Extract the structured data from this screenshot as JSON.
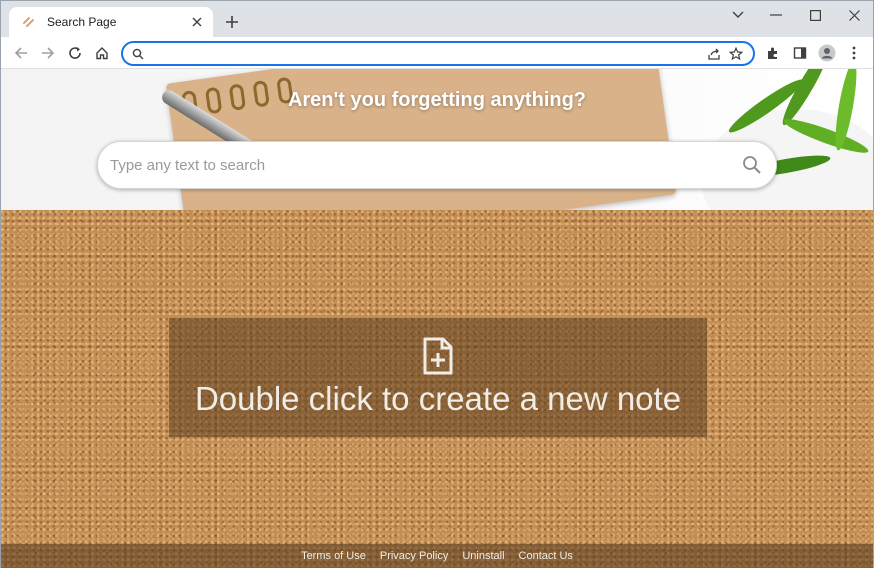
{
  "browser": {
    "tab_title": "Search Page",
    "omnibox_value": "",
    "window_controls": [
      "minimize-icon",
      "maximize-icon",
      "close-icon"
    ]
  },
  "page": {
    "hero_title": "Aren't you forgetting anything?",
    "search_placeholder": "Type any text to search",
    "note_prompt": "Double click to create a new note",
    "footer_links": [
      {
        "label": "Terms of Use"
      },
      {
        "label": "Privacy Policy"
      },
      {
        "label": "Uninstall"
      },
      {
        "label": "Contact Us"
      }
    ]
  },
  "colors": {
    "accent": "#1a73e8",
    "cork": "#c48d53",
    "note_overlay": "#5a3c1e"
  }
}
